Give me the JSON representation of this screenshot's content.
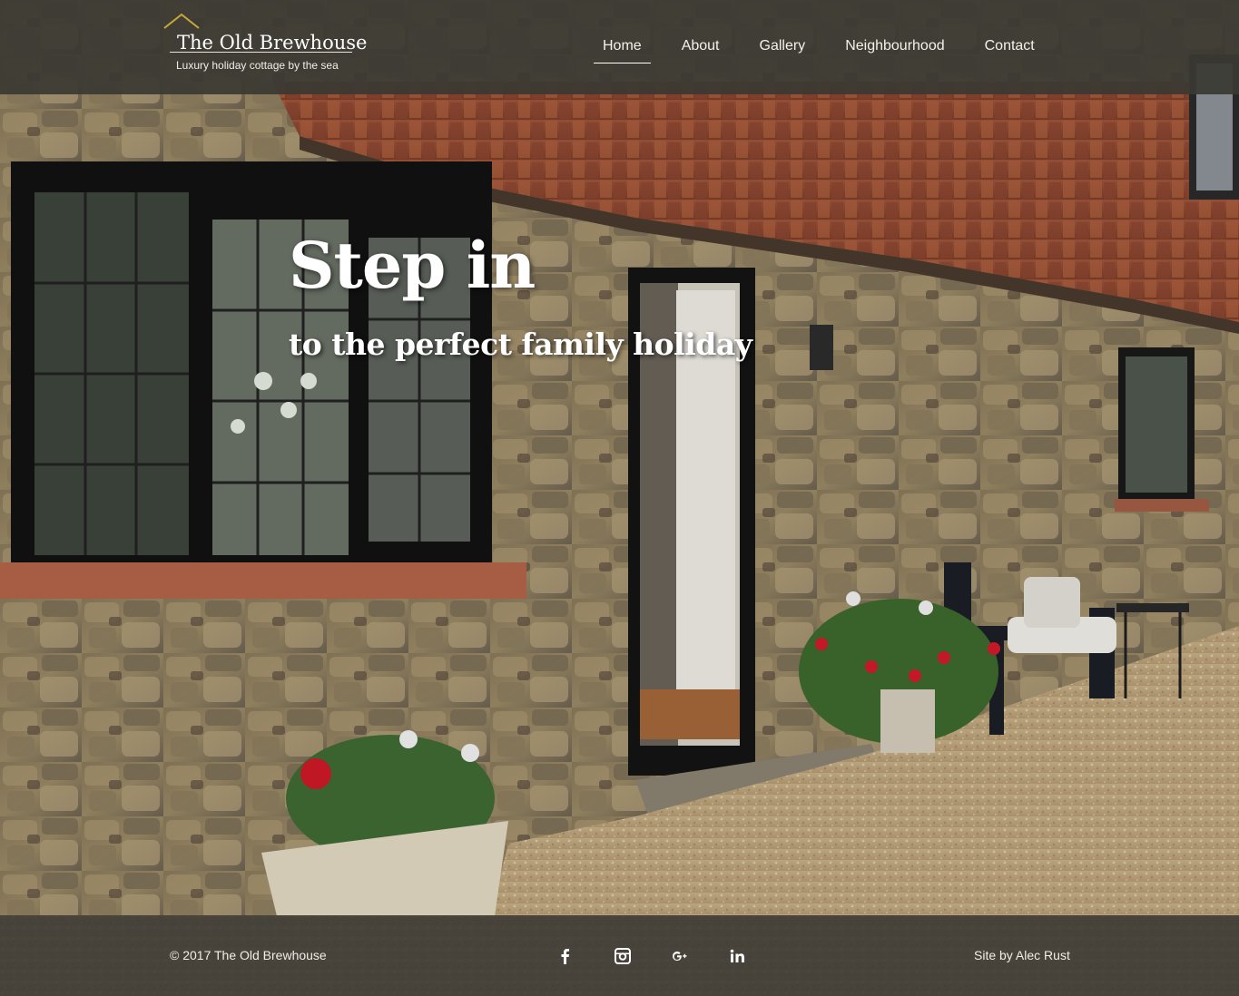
{
  "site": {
    "logo_title": "The Old Brewhouse",
    "logo_tagline": "Luxury holiday cottage by the sea",
    "accent_color": "#c9a93a"
  },
  "nav": {
    "items": [
      {
        "label": "Home",
        "active": true
      },
      {
        "label": "About",
        "active": false
      },
      {
        "label": "Gallery",
        "active": false
      },
      {
        "label": "Neighbourhood",
        "active": false
      },
      {
        "label": "Contact",
        "active": false
      }
    ]
  },
  "hero": {
    "title": "Step in",
    "subtitle": "to the perfect family holiday"
  },
  "footer": {
    "copyright": "© 2017 The Old Brewhouse",
    "credit_prefix": "Site by ",
    "credit_name": "Alec Rust",
    "social": [
      {
        "icon": "facebook-icon"
      },
      {
        "icon": "instagram-icon"
      },
      {
        "icon": "google-plus-icon"
      },
      {
        "icon": "linkedin-icon"
      }
    ]
  }
}
